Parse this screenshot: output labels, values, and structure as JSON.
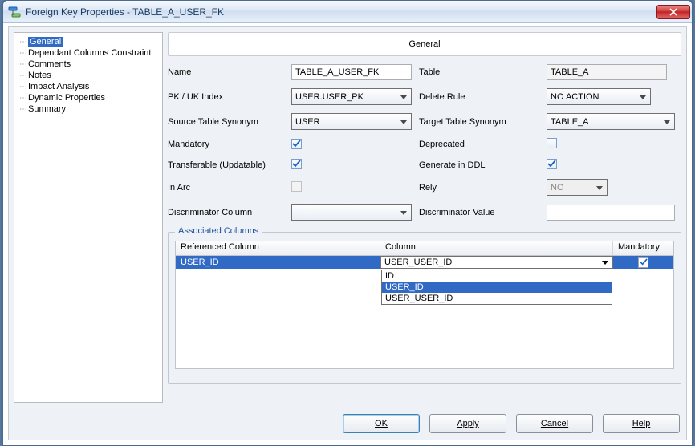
{
  "window": {
    "title": "Foreign Key Properties - TABLE_A_USER_FK"
  },
  "sidebar": {
    "items": [
      {
        "label": "General",
        "selected": true
      },
      {
        "label": "Dependant Columns Constraint"
      },
      {
        "label": "Comments"
      },
      {
        "label": "Notes"
      },
      {
        "label": "Impact Analysis"
      },
      {
        "label": "Dynamic Properties"
      },
      {
        "label": "Summary"
      }
    ]
  },
  "panel": {
    "heading": "General",
    "labels": {
      "name": "Name",
      "table": "Table",
      "pkuk": "PK / UK Index",
      "deleteRule": "Delete Rule",
      "srcSyn": "Source Table Synonym",
      "tgtSyn": "Target Table Synonym",
      "mandatory": "Mandatory",
      "deprecated": "Deprecated",
      "transferable": "Transferable (Updatable)",
      "genddl": "Generate in DDL",
      "inarc": "In Arc",
      "rely": "Rely",
      "discCol": "Discriminator Column",
      "discVal": "Discriminator Value"
    },
    "values": {
      "name": "TABLE_A_USER_FK",
      "table": "TABLE_A",
      "pkuk": "USER.USER_PK",
      "deleteRule": "NO ACTION",
      "srcSyn": "USER",
      "tgtSyn": "TABLE_A",
      "rely": "NO",
      "discCol": "",
      "discVal": ""
    },
    "checks": {
      "mandatory": true,
      "deprecated": false,
      "transferable": true,
      "genddl": true,
      "inarc": false
    }
  },
  "assoc": {
    "legend": "Associated Columns",
    "headers": {
      "ref": "Referenced Column",
      "col": "Column",
      "mand": "Mandatory"
    },
    "row": {
      "ref": "USER_ID",
      "selected": "USER_USER_ID",
      "mandatory": true,
      "options": [
        "ID",
        "USER_ID",
        "USER_USER_ID"
      ],
      "highlight": "USER_ID"
    }
  },
  "buttons": {
    "ok": "OK",
    "apply": "Apply",
    "cancel": "Cancel",
    "help": "Help"
  }
}
